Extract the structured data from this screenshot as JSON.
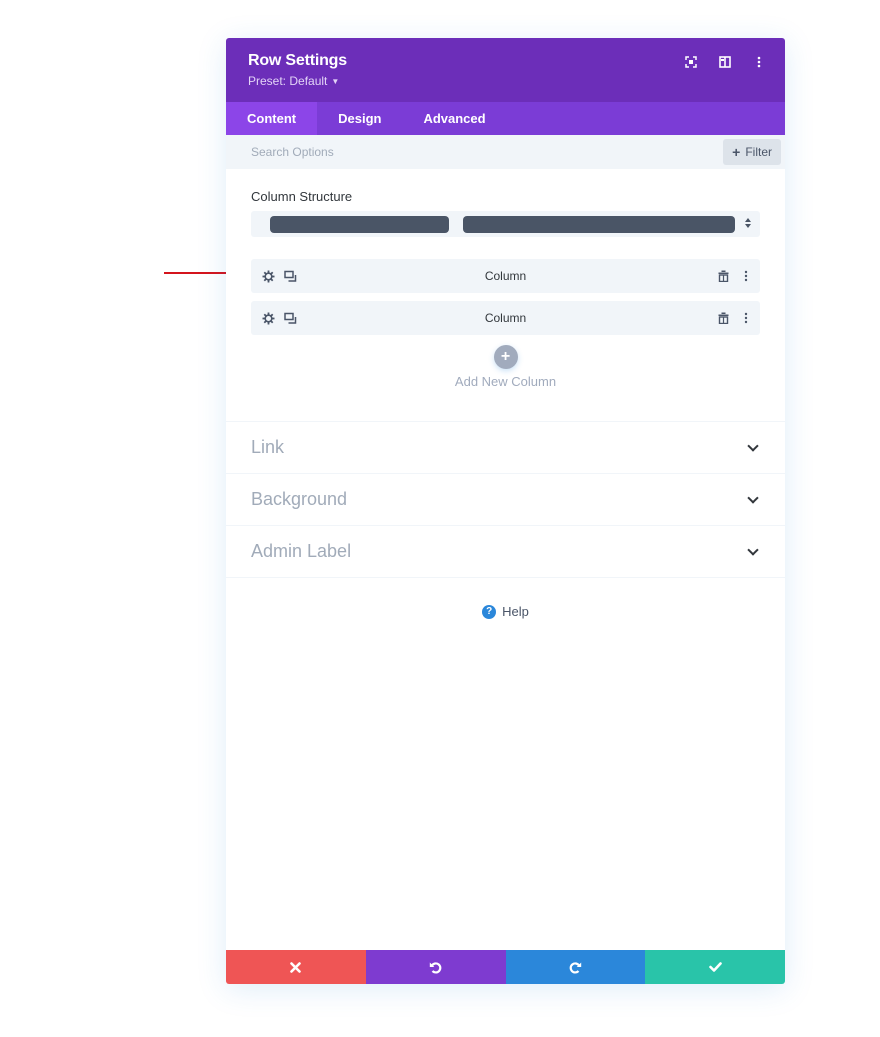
{
  "header": {
    "title": "Row Settings",
    "preset_label": "Preset: Default",
    "icons": [
      "focus-mode-icon",
      "split-view-icon",
      "more-options-icon"
    ]
  },
  "tabs": [
    {
      "label": "Content",
      "active": true
    },
    {
      "label": "Design",
      "active": false
    },
    {
      "label": "Advanced",
      "active": false
    }
  ],
  "search": {
    "placeholder": "Search Options",
    "value": "",
    "filter_label": "Filter"
  },
  "column_structure": {
    "label": "Column Structure",
    "selected_layout": "1/3 + 2/3"
  },
  "columns": [
    {
      "title": "Column"
    },
    {
      "title": "Column"
    }
  ],
  "add_column_label": "Add New Column",
  "toggles": [
    {
      "title": "Link"
    },
    {
      "title": "Background"
    },
    {
      "title": "Admin Label"
    }
  ],
  "help_label": "Help",
  "footer": {
    "buttons": [
      "cancel",
      "undo",
      "redo",
      "save"
    ]
  },
  "colors": {
    "header": "#6c2eb9",
    "tabs": "#7b3cd6",
    "tab_active": "#8c45e8",
    "cancel": "#ef5555",
    "undo": "#7e3bd0",
    "redo": "#2b87da",
    "save": "#29c4a9",
    "annotation_arrow": "#d4141c"
  }
}
